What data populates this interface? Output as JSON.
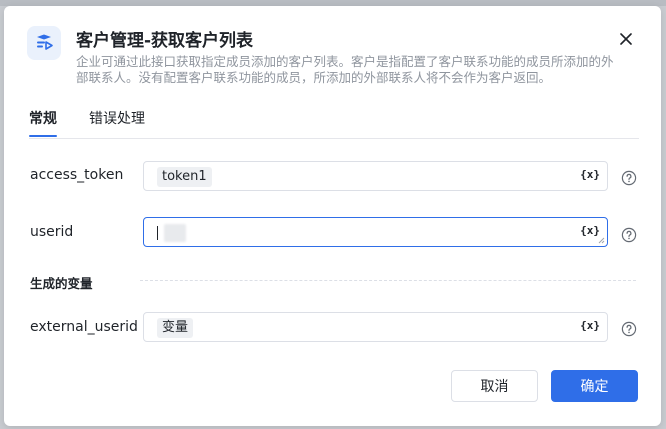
{
  "dialog": {
    "title": "客户管理-获取客户列表",
    "description": "企业可通过此接口获取指定成员添加的客户列表。客户是指配置了客户联系功能的成员所添加的外部联系人。没有配置客户联系功能的成员，所添加的外部联系人将不会作为客户返回。",
    "icon": "connector-app-icon",
    "close_icon": "close-icon"
  },
  "tabs": [
    {
      "label": "常规",
      "active": true
    },
    {
      "label": "错误处理",
      "active": false
    }
  ],
  "fields": [
    {
      "label": "access_token",
      "value": "token1",
      "var_label": "{x}"
    },
    {
      "label": "userid",
      "value": "",
      "var_label": "{x}"
    }
  ],
  "output_section": {
    "title": "生成的变量",
    "fields": [
      {
        "label": "external_userid",
        "value": "变量",
        "var_label": "{x}"
      }
    ]
  },
  "buttons": {
    "cancel": "取消",
    "confirm": "确定"
  },
  "colors": {
    "primary": "#2f6ee8",
    "text": "#1f2329",
    "muted": "#8f959e",
    "border": "#dcdfe6"
  }
}
